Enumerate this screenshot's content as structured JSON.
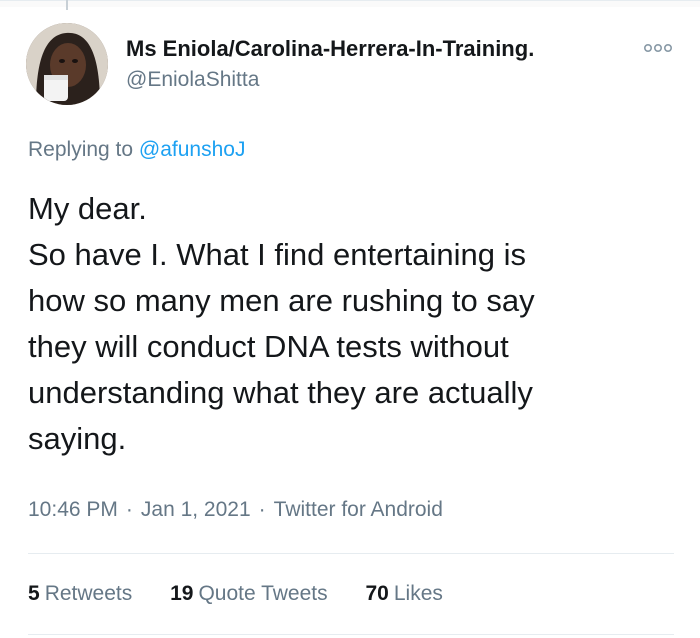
{
  "user": {
    "display_name": "Ms Eniola/Carolina-Herrera-In-Training.",
    "handle": "@EniolaShitta"
  },
  "reply": {
    "prefix": "Replying to",
    "mention": "@afunshoJ"
  },
  "tweet": {
    "lines": [
      "My dear.",
      "So have I. What I find entertaining is",
      "how so many men are rushing to say",
      "they will conduct DNA tests without",
      "understanding what they are actually",
      "saying."
    ]
  },
  "meta": {
    "time": "10:46 PM",
    "separator": "·",
    "date": "Jan 1, 2021",
    "source": "Twitter for Android"
  },
  "stats": [
    {
      "count": "5",
      "label": "Retweets"
    },
    {
      "count": "19",
      "label": "Quote Tweets"
    },
    {
      "count": "70",
      "label": "Likes"
    }
  ],
  "colors": {
    "text": "#14171a",
    "secondary": "#657786",
    "link": "#1da1f2",
    "divider": "#e6ecf0"
  },
  "icons": [
    "more-options-icon"
  ]
}
